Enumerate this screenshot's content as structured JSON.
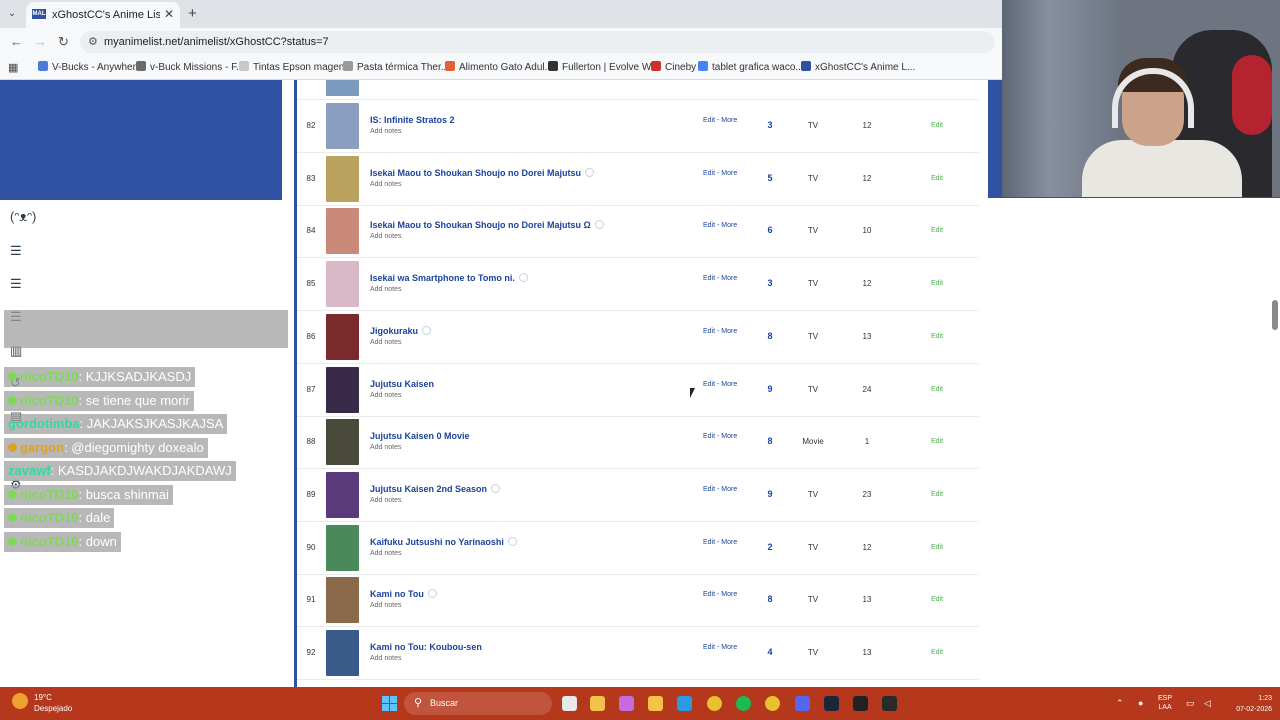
{
  "browser": {
    "tab_title": "xGhostCC's Anime List - MyAnimeList.net",
    "tab_favicon_text": "MAL",
    "url": "myanimelist.net/animelist/xGhostCC?status=7",
    "bookmarks": [
      {
        "label": "V-Bucks - Anywhere",
        "color": "#4a7bd8"
      },
      {
        "label": "v-Buck Missions - F...",
        "color": "#6b6b6b"
      },
      {
        "label": "Tintas Epson magen...",
        "color": "#c8c8c8"
      },
      {
        "label": "Pasta térmica Ther...",
        "color": "#9a9a9a"
      },
      {
        "label": "Alimento Gato Adul...",
        "color": "#e0603a"
      },
      {
        "label": "Fullerton | Evolve W...",
        "color": "#333333"
      },
      {
        "label": "Cineby",
        "color": "#d0302a"
      },
      {
        "label": "tablet grafica waco...",
        "color": "#4285f4"
      },
      {
        "label": "xGhostCC's Anime L...",
        "color": "#2e51a2"
      }
    ]
  },
  "anime_list": {
    "edit_more_label": "Edit - More",
    "add_notes_label": "Add notes",
    "edit_label": "Edit",
    "rows": [
      {
        "num": "82",
        "title": "IS: Infinite Stratos 2",
        "info": false,
        "score": "3",
        "type": "TV",
        "eps": "12",
        "cover": "#8a9fbf"
      },
      {
        "num": "83",
        "title": "Isekai Maou to Shoukan Shoujo no Dorei Majutsu",
        "info": true,
        "score": "5",
        "type": "TV",
        "eps": "12",
        "cover": "#b9a35e"
      },
      {
        "num": "84",
        "title": "Isekai Maou to Shoukan Shoujo no Dorei Majutsu Ω",
        "info": true,
        "score": "6",
        "type": "TV",
        "eps": "10",
        "cover": "#c98a7a"
      },
      {
        "num": "85",
        "title": "Isekai wa Smartphone to Tomo ni.",
        "info": true,
        "score": "3",
        "type": "TV",
        "eps": "12",
        "cover": "#d9b8c8"
      },
      {
        "num": "86",
        "title": "Jigokuraku",
        "info": true,
        "score": "8",
        "type": "TV",
        "eps": "13",
        "cover": "#7a2a2a"
      },
      {
        "num": "87",
        "title": "Jujutsu Kaisen",
        "info": false,
        "score": "9",
        "type": "TV",
        "eps": "24",
        "cover": "#3a2a4a"
      },
      {
        "num": "88",
        "title": "Jujutsu Kaisen 0 Movie",
        "info": false,
        "score": "8",
        "type": "Movie",
        "eps": "1",
        "cover": "#4a4a3a"
      },
      {
        "num": "89",
        "title": "Jujutsu Kaisen 2nd Season",
        "info": true,
        "score": "9",
        "type": "TV",
        "eps": "23",
        "cover": "#5a3a7a"
      },
      {
        "num": "90",
        "title": "Kaifuku Jutsushi no Yarinaoshi",
        "info": true,
        "score": "2",
        "type": "TV",
        "eps": "12",
        "cover": "#4a8a5a"
      },
      {
        "num": "91",
        "title": "Kami no Tou",
        "info": true,
        "score": "8",
        "type": "TV",
        "eps": "13",
        "cover": "#8a6a4a"
      },
      {
        "num": "92",
        "title": "Kami no Tou: Koubou-sen",
        "info": false,
        "score": "4",
        "type": "TV",
        "eps": "13",
        "cover": "#3a5a8a"
      }
    ]
  },
  "chat": {
    "lines": [
      {
        "user": "nicoTD10",
        "text": "KJJKSADJKASDJ",
        "user_color": "#7ed957",
        "badge": "#7ed957"
      },
      {
        "user": "nicoTD10",
        "text": "se tiene que morir",
        "user_color": "#7ed957",
        "badge": "#7ed957"
      },
      {
        "user": "gordotimba",
        "text": "JAKJAKSJKASJKAJSA",
        "user_color": "#2fd9a4",
        "badge": ""
      },
      {
        "user": "gargon",
        "text": "@diegomighty doxealo",
        "user_color": "#e0a020",
        "badge": "#e0a020"
      },
      {
        "user": "zavawf",
        "text": "KASDJAKDJWAKDJAKDAWJ",
        "user_color": "#2fd9a4",
        "badge": ""
      },
      {
        "user": "nicoTD10",
        "text": "busca shinmai",
        "user_color": "#7ed957",
        "badge": "#7ed957"
      },
      {
        "user": "nicoTD10",
        "text": "dale",
        "user_color": "#7ed957",
        "badge": "#7ed957"
      },
      {
        "user": "nicoTD10",
        "text": "down",
        "user_color": "#7ed957",
        "badge": "#7ed957"
      }
    ]
  },
  "taskbar": {
    "temp": "19°C",
    "weather": "Despejado",
    "search_placeholder": "Buscar",
    "lang": "ESP",
    "lang_sub": "LAA",
    "time": "1:23",
    "date": "07-02-2026"
  }
}
